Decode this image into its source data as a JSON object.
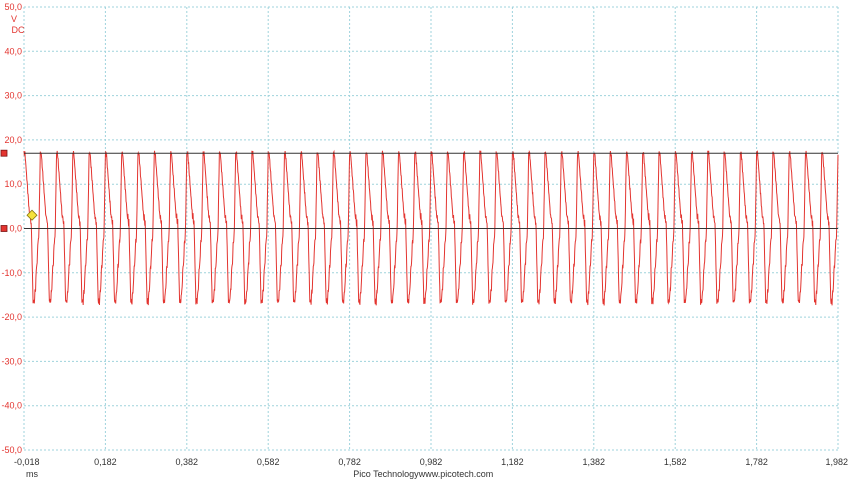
{
  "chart_data": {
    "type": "line",
    "title": "",
    "channel": {
      "unit": "V",
      "coupling": "DC",
      "color": "#e3342f"
    },
    "xlabel": "ms",
    "ylabel": "V",
    "xlim": [
      -0.018,
      1.982
    ],
    "ylim": [
      -50.0,
      50.0
    ],
    "x_ticks": [
      "-0,018",
      "0,182",
      "0,382",
      "0,582",
      "0,782",
      "0,982",
      "1,182",
      "1,382",
      "1,582",
      "1,782",
      "1,982"
    ],
    "y_ticks": [
      "50,0",
      "40,0",
      "30,0",
      "20,0",
      "10,0",
      "0,0",
      "-10,0",
      "-20,0",
      "-30,0",
      "-40,0",
      "-50,0"
    ],
    "grid": true,
    "series": [
      {
        "values_description_omitted": true,
        "waveform": {
          "cycles": 50,
          "period_ms": 0.04,
          "peak_max": 17.0,
          "peak_min": -17.0,
          "flat_top": true
        }
      }
    ],
    "markers": {
      "trigger_level": 3.0,
      "trigger_time": -0.018,
      "ruler_upper": 17.0,
      "ruler_lower": 0.0
    }
  },
  "footer": {
    "brand": "Pico Technology",
    "url": "www.picotech.com"
  },
  "colors": {
    "trace": "#e3342f",
    "grid": "#9fd3dc",
    "ruler": "#333333",
    "trigger": "#f5e13b"
  }
}
